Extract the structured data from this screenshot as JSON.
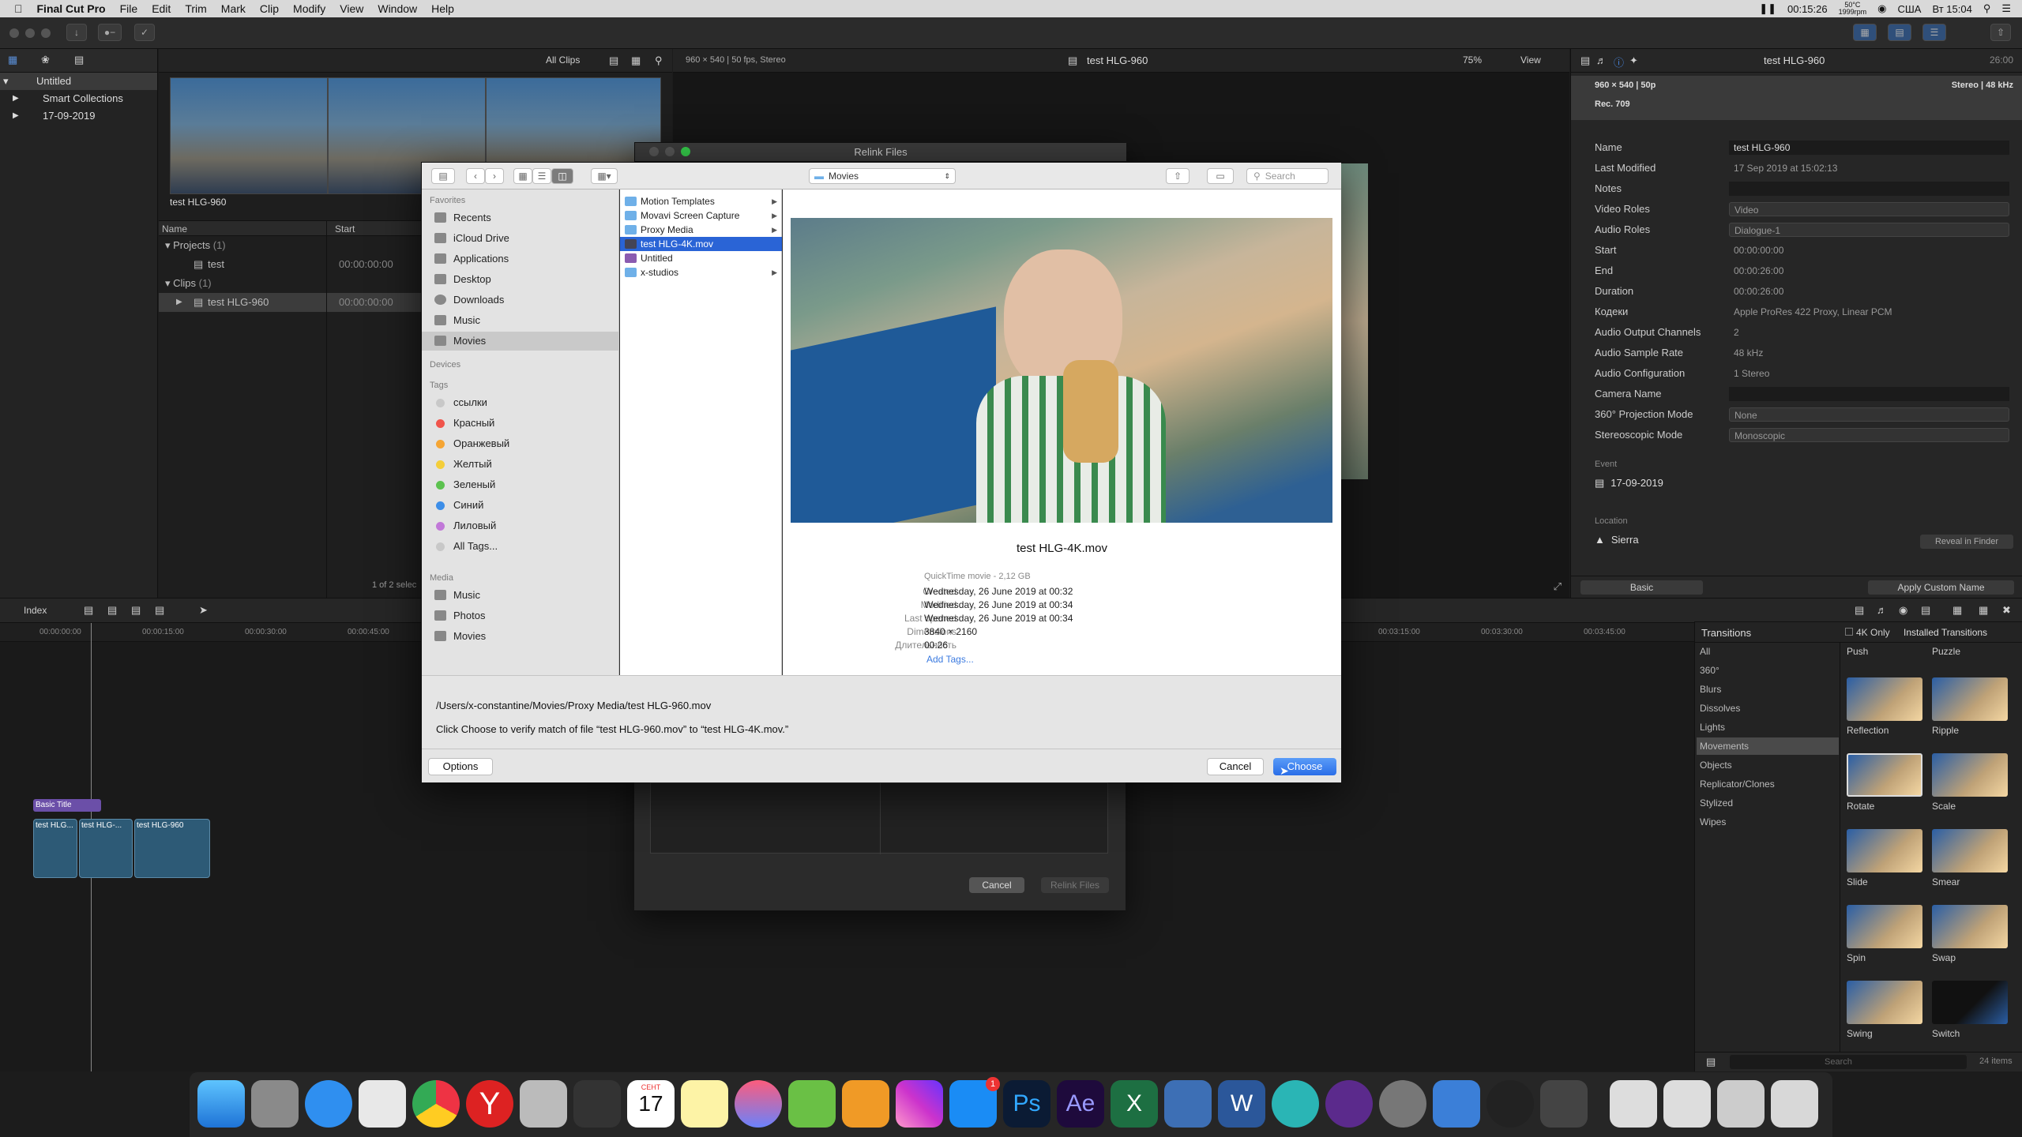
{
  "menubar": {
    "app": "Final Cut Pro",
    "items": [
      "File",
      "Edit",
      "Trim",
      "Mark",
      "Clip",
      "Modify",
      "View",
      "Window",
      "Help"
    ],
    "time_text": "00:15:26",
    "temp": "50°C",
    "rpm": "1999rpm",
    "locale": "США",
    "clock": "Вт 15:04"
  },
  "library": {
    "items": [
      "Untitled",
      "Smart Collections",
      "17-09-2019"
    ]
  },
  "browser": {
    "filter": "All Clips",
    "clip_name": "test HLG-960",
    "col_name": "Name",
    "col_start": "Start",
    "projects": "Projects",
    "projects_count": "(1)",
    "project_item": "test",
    "project_time": "00:00:00:00",
    "clips": "Clips",
    "clips_count": "(1)",
    "clip_item": "test HLG-960",
    "clip_time": "00:00:00:00",
    "status": "1 of 2 selec"
  },
  "viewer": {
    "format": "960 × 540 | 50 fps, Stereo",
    "title": "test HLG-960",
    "zoom": "75%",
    "view": "View"
  },
  "inspector": {
    "title": "test HLG-960",
    "timecode": "26:00",
    "format_line": "960 × 540 | 50p",
    "audio_line": "Stereo | 48 kHz",
    "colorspace": "Rec. 709",
    "rows": [
      {
        "label": "Name",
        "value": "test HLG-960"
      },
      {
        "label": "Last Modified",
        "value": "17 Sep 2019 at 15:02:13"
      },
      {
        "label": "Notes",
        "value": ""
      },
      {
        "label": "Video Roles",
        "value": "Video"
      },
      {
        "label": "Audio Roles",
        "value": "Dialogue-1"
      },
      {
        "label": "Start",
        "value": "00:00:00:00"
      },
      {
        "label": "End",
        "value": "00:00:26:00"
      },
      {
        "label": "Duration",
        "value": "00:00:26:00"
      },
      {
        "label": "Кодеки",
        "value": "Apple ProRes 422 Proxy, Linear PCM"
      },
      {
        "label": "Audio Output Channels",
        "value": "2"
      },
      {
        "label": "Audio Sample Rate",
        "value": "48 kHz"
      },
      {
        "label": "Audio Configuration",
        "value": "1 Stereo"
      },
      {
        "label": "Camera Name",
        "value": ""
      },
      {
        "label": "360° Projection Mode",
        "value": "None"
      },
      {
        "label": "Stereoscopic Mode",
        "value": "Monoscopic"
      }
    ],
    "event_label": "Event",
    "event_value": "17-09-2019",
    "location_label": "Location",
    "location_value": "Sierra",
    "reveal": "Reveal in Finder",
    "basic": "Basic",
    "apply": "Apply Custom Name"
  },
  "timeline": {
    "index": "Index",
    "ticks": [
      "00:00:00:00",
      "00:00:15:00",
      "00:00:30:00",
      "00:00:45:00",
      "00:03:15:00",
      "00:03:30:00",
      "00:03:45:00"
    ],
    "title_clip": "Basic Title",
    "clips": [
      "test HLG...",
      "test HLG-...",
      "test HLG-960"
    ]
  },
  "transitions": {
    "title": "Transitions",
    "only4k": "4K Only",
    "installed": "Installed Transitions",
    "categories": [
      "All",
      "360°",
      "Blurs",
      "Dissolves",
      "Lights",
      "Movements",
      "Objects",
      "Replicator/Clones",
      "Stylized",
      "Wipes"
    ],
    "tiles": [
      "Push",
      "Puzzle",
      "Reflection",
      "Ripple",
      "Rotate",
      "Scale",
      "Slide",
      "Smear",
      "Spin",
      "Swap",
      "Swing",
      "Switch"
    ],
    "search": "Search",
    "count": "24 items"
  },
  "relink": {
    "title": "Relink Files",
    "cancel": "Cancel",
    "relink": "Relink Files"
  },
  "panel": {
    "location": "Movies",
    "search": "Search",
    "favorites_label": "Favorites",
    "favorites": [
      "Recents",
      "iCloud Drive",
      "Applications",
      "Desktop",
      "Downloads",
      "Music",
      "Movies"
    ],
    "devices_label": "Devices",
    "tags_label": "Tags",
    "tags": [
      {
        "name": "ссылки",
        "color": "#c8c8c8"
      },
      {
        "name": "Красный",
        "color": "#f0544b"
      },
      {
        "name": "Оранжевый",
        "color": "#f5a534"
      },
      {
        "name": "Желтый",
        "color": "#f4ce3a"
      },
      {
        "name": "Зеленый",
        "color": "#5cc24f"
      },
      {
        "name": "Синий",
        "color": "#3d8ee8"
      },
      {
        "name": "Лиловый",
        "color": "#c178d8"
      },
      {
        "name": "All Tags...",
        "color": "#c8c8c8"
      }
    ],
    "media_label": "Media",
    "media": [
      "Music",
      "Photos",
      "Movies"
    ],
    "files": [
      "Motion Templates",
      "Movavi Screen Capture",
      "Proxy Media",
      "test HLG-4K.mov",
      "Untitled",
      "x-studios"
    ],
    "preview_name": "test HLG-4K.mov",
    "kind": "QuickTime movie - 2,12 GB",
    "meta": [
      {
        "label": "Created",
        "value": "Wednesday, 26 June 2019 at 00:32"
      },
      {
        "label": "Modified",
        "value": "Wednesday, 26 June 2019 at 00:34"
      },
      {
        "label": "Last opened",
        "value": "Wednesday, 26 June 2019 at 00:34"
      },
      {
        "label": "Dimensions",
        "value": "3840 × 2160"
      },
      {
        "label": "Длительность",
        "value": "00:26"
      }
    ],
    "add_tags": "Add Tags...",
    "path": "/Users/x-constantine/Movies/Proxy Media/test HLG-960.mov",
    "hint": "Click Choose to verify match of file “test HLG-960.mov” to “test HLG-4K.mov.”",
    "options": "Options",
    "cancel": "Cancel",
    "choose": "Choose"
  },
  "dock": {
    "calendar_month": "СЕНТ",
    "calendar_day": "17",
    "badge": "1"
  }
}
